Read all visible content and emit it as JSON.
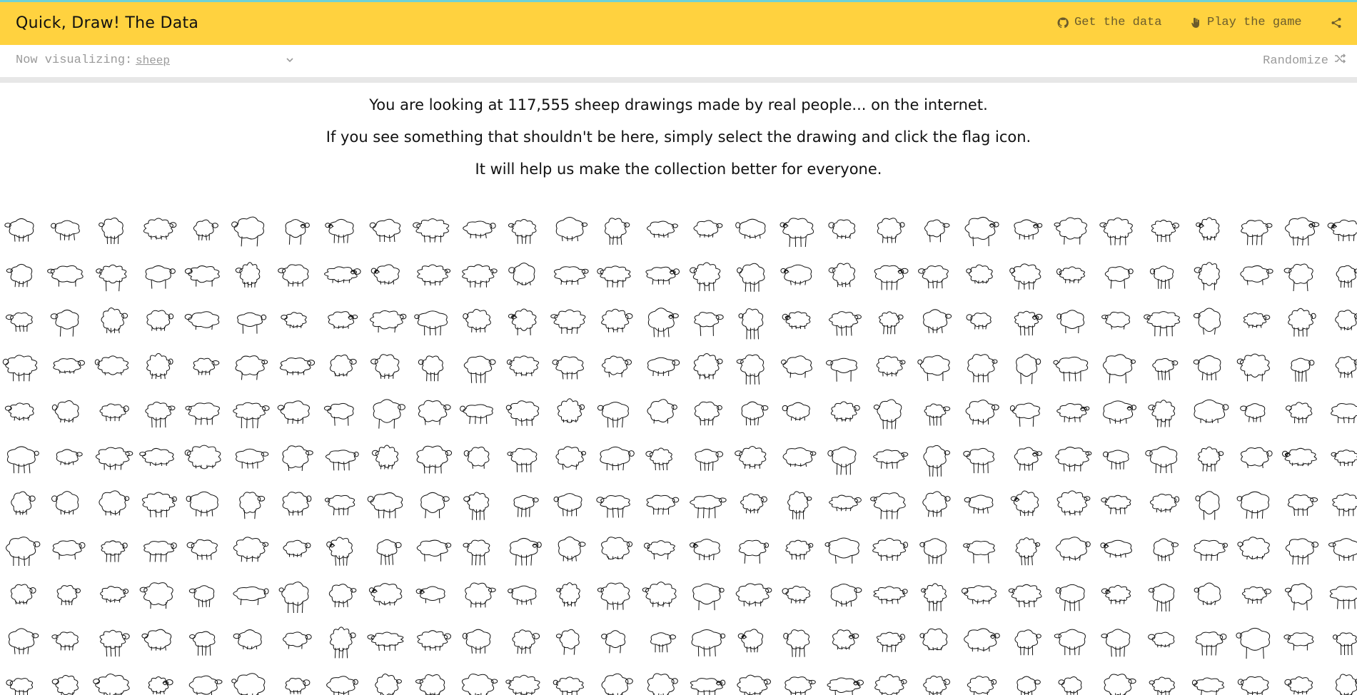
{
  "header": {
    "title": "Quick, Draw! The Data",
    "links": [
      {
        "label": "Get the data",
        "icon": "github-icon"
      },
      {
        "label": "Play the game",
        "icon": "hand-icon"
      }
    ],
    "share_icon": "share-icon"
  },
  "subbar": {
    "label": "Now visualizing:",
    "selected": "sheep",
    "randomize": "Randomize"
  },
  "intro": {
    "line1": "You are looking at 117,555 sheep drawings made by real people... on the internet.",
    "line2": "If you see something that shouldn't be here, simply select the drawing and click the flag icon.",
    "line3": "It will help us make the collection better for everyone."
  },
  "grid": {
    "columns": 30,
    "rows": 11,
    "item": "sheep drawing"
  },
  "colors": {
    "header_bg": "#ffd23f",
    "accent_line": "#6fd2d5",
    "link_text": "#6b5c2c",
    "muted_text": "#9a9a9a"
  }
}
